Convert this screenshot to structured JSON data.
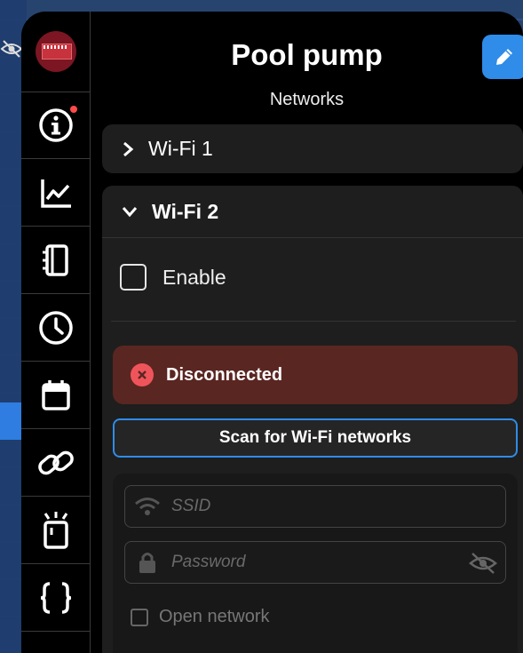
{
  "header": {
    "title": "Pool pump",
    "subtitle": "Networks"
  },
  "sidebar": {
    "items": [
      {
        "name": "device-logo",
        "icon": "device-board-logo"
      },
      {
        "name": "info",
        "icon": "info-icon",
        "notification": true
      },
      {
        "name": "charts",
        "icon": "chart-line-icon"
      },
      {
        "name": "logs",
        "icon": "notebook-icon"
      },
      {
        "name": "schedules",
        "icon": "clock-icon"
      },
      {
        "name": "calendar",
        "icon": "calendar-icon"
      },
      {
        "name": "links",
        "icon": "link-icon"
      },
      {
        "name": "device-identify",
        "icon": "device-blink-icon"
      },
      {
        "name": "scripts",
        "icon": "braces-icon"
      }
    ]
  },
  "networks": {
    "wifi1": {
      "label": "Wi-Fi 1",
      "expanded": false
    },
    "wifi2": {
      "label": "Wi-Fi 2",
      "expanded": true,
      "enable_label": "Enable",
      "enabled": false,
      "status": "Disconnected",
      "scan_label": "Scan for Wi-Fi networks",
      "ssid_placeholder": "SSID",
      "password_placeholder": "Password",
      "open_network_label": "Open network",
      "open_network": false
    }
  },
  "colors": {
    "accent": "#2f8ce8",
    "error_bg": "#5a2622",
    "error_icon": "#f0545b",
    "notification": "#ff4a4a"
  }
}
